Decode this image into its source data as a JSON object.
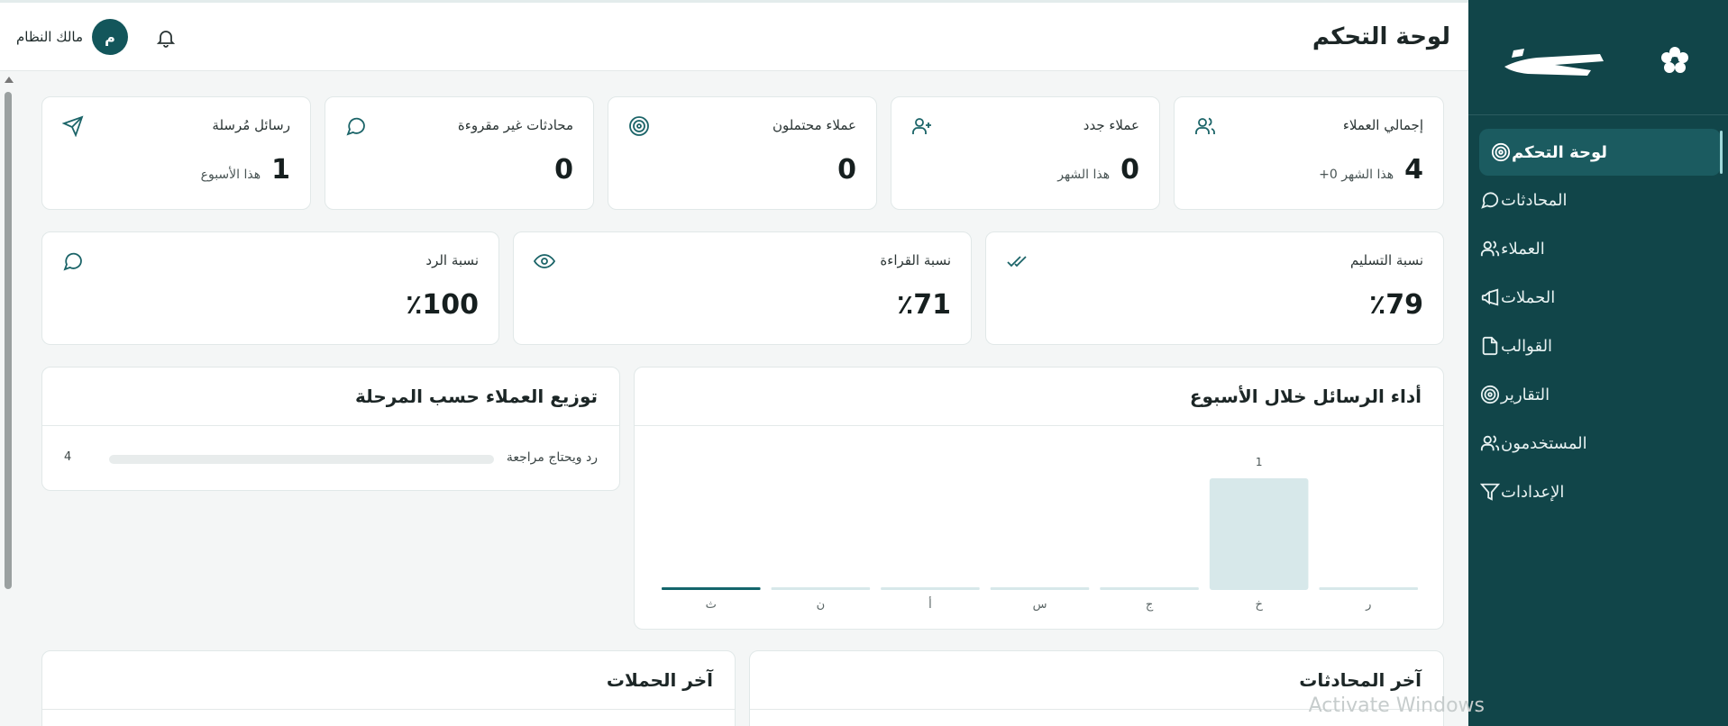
{
  "sidebar": {
    "brand_logo_icon": "flower-logo-icon",
    "items": [
      {
        "label": "لوحة التحكم",
        "icon": "target-icon",
        "active": true
      },
      {
        "label": "المحادثات",
        "icon": "chat-bubble-icon"
      },
      {
        "label": "العملاء",
        "icon": "users-icon"
      },
      {
        "label": "الحملات",
        "icon": "megaphone-icon"
      },
      {
        "label": "القوالب",
        "icon": "file-icon"
      },
      {
        "label": "التقارير",
        "icon": "target-icon"
      },
      {
        "label": "المستخدمون",
        "icon": "users-icon"
      },
      {
        "label": "الإعدادات",
        "icon": "filter-icon"
      }
    ]
  },
  "header": {
    "title": "لوحة التحكم",
    "user_name": "مالك النظام",
    "avatar_initial": "م"
  },
  "stats_row1": [
    {
      "label": "إجمالي العملاء",
      "value": "4",
      "sub": "+0 هذا الشهر",
      "icon": "users-icon"
    },
    {
      "label": "عملاء جدد",
      "value": "0",
      "sub": "هذا الشهر",
      "icon": "user-plus-icon"
    },
    {
      "label": "عملاء محتملون",
      "value": "0",
      "sub": "",
      "icon": "target-icon"
    },
    {
      "label": "محادثات غير مقروءة",
      "value": "0",
      "sub": "",
      "icon": "chat-bubble-icon"
    },
    {
      "label": "رسائل مُرسلة",
      "value": "1",
      "sub": "هذا الأسبوع",
      "icon": "send-icon"
    }
  ],
  "stats_row2": [
    {
      "label": "نسبة التسليم",
      "value": "79",
      "suffix": "٪",
      "icon": "double-check-icon"
    },
    {
      "label": "نسبة القراءة",
      "value": "71",
      "suffix": "٪",
      "icon": "eye-icon"
    },
    {
      "label": "نسبة الرد",
      "value": "100",
      "suffix": "٪",
      "icon": "chat-bubble-icon"
    }
  ],
  "weekly_chart": {
    "title": "أداء الرسائل خلال الأسبوع"
  },
  "chart_data": {
    "type": "bar",
    "categories": [
      "ر",
      "خ",
      "ج",
      "س",
      "أ",
      "ن",
      "ث"
    ],
    "values": [
      0,
      1,
      0,
      0,
      0,
      0,
      0
    ],
    "data_labels": [
      "",
      "1",
      "",
      "",
      "",
      "",
      ""
    ],
    "highlight_category": "ث",
    "ylim": [
      0,
      1
    ],
    "colors": {
      "bar": "#d7e8ea",
      "highlight": "#13656b"
    }
  },
  "distribution": {
    "title": "توزيع العملاء حسب المرحلة",
    "rows": [
      {
        "label": "رد ويحتاج مراجعة",
        "count": "4",
        "fraction": 0
      }
    ]
  },
  "recent_conversations": {
    "title": "آخر المحادثات"
  },
  "recent_campaigns": {
    "title": "آخر الحملات"
  },
  "watermark": "Activate Windows",
  "colors": {
    "sidebar": "#114549",
    "accent": "#13565b",
    "icon": "#1b6468"
  }
}
